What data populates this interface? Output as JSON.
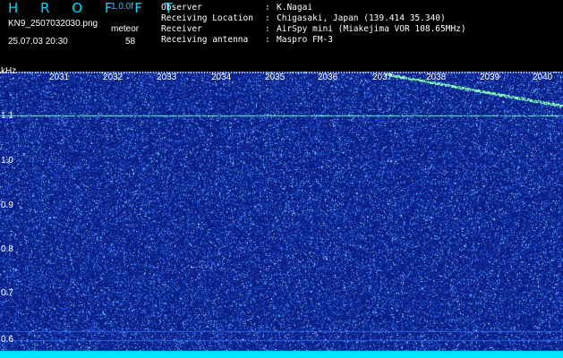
{
  "app": {
    "logo": "H R O F F T",
    "version": "1.0.0f",
    "filename": "KN9_2507032030.png",
    "datetime": "25.07.03 20:30",
    "meteor_label": "meteor",
    "meteor_count": "58"
  },
  "meta": {
    "observer_label": "Observer",
    "observer_value": "K.Nagai",
    "location_label": "Receiving Location",
    "location_value": "Chigasaki, Japan (139.414 35.340)",
    "receiver_label": "Receiver",
    "receiver_value": "AirSpy mini (Miakejima VOR 108.65MHz)",
    "antenna_label": "Receiving antenna",
    "antenna_value": "Maspro FM-3"
  },
  "axis": {
    "unit": "kHz",
    "y_ticks": [
      "1.1",
      "1.0",
      "0.9",
      "0.8",
      "0.7",
      "0.6"
    ],
    "x_ticks": [
      "2031",
      "2032",
      "2033",
      "2034",
      "2035",
      "2036",
      "2037",
      "2038",
      "2039",
      "2040"
    ]
  },
  "colors": {
    "background": "#0a1f86",
    "accent": "#00d9ff",
    "signal": "#7dfcd8"
  }
}
